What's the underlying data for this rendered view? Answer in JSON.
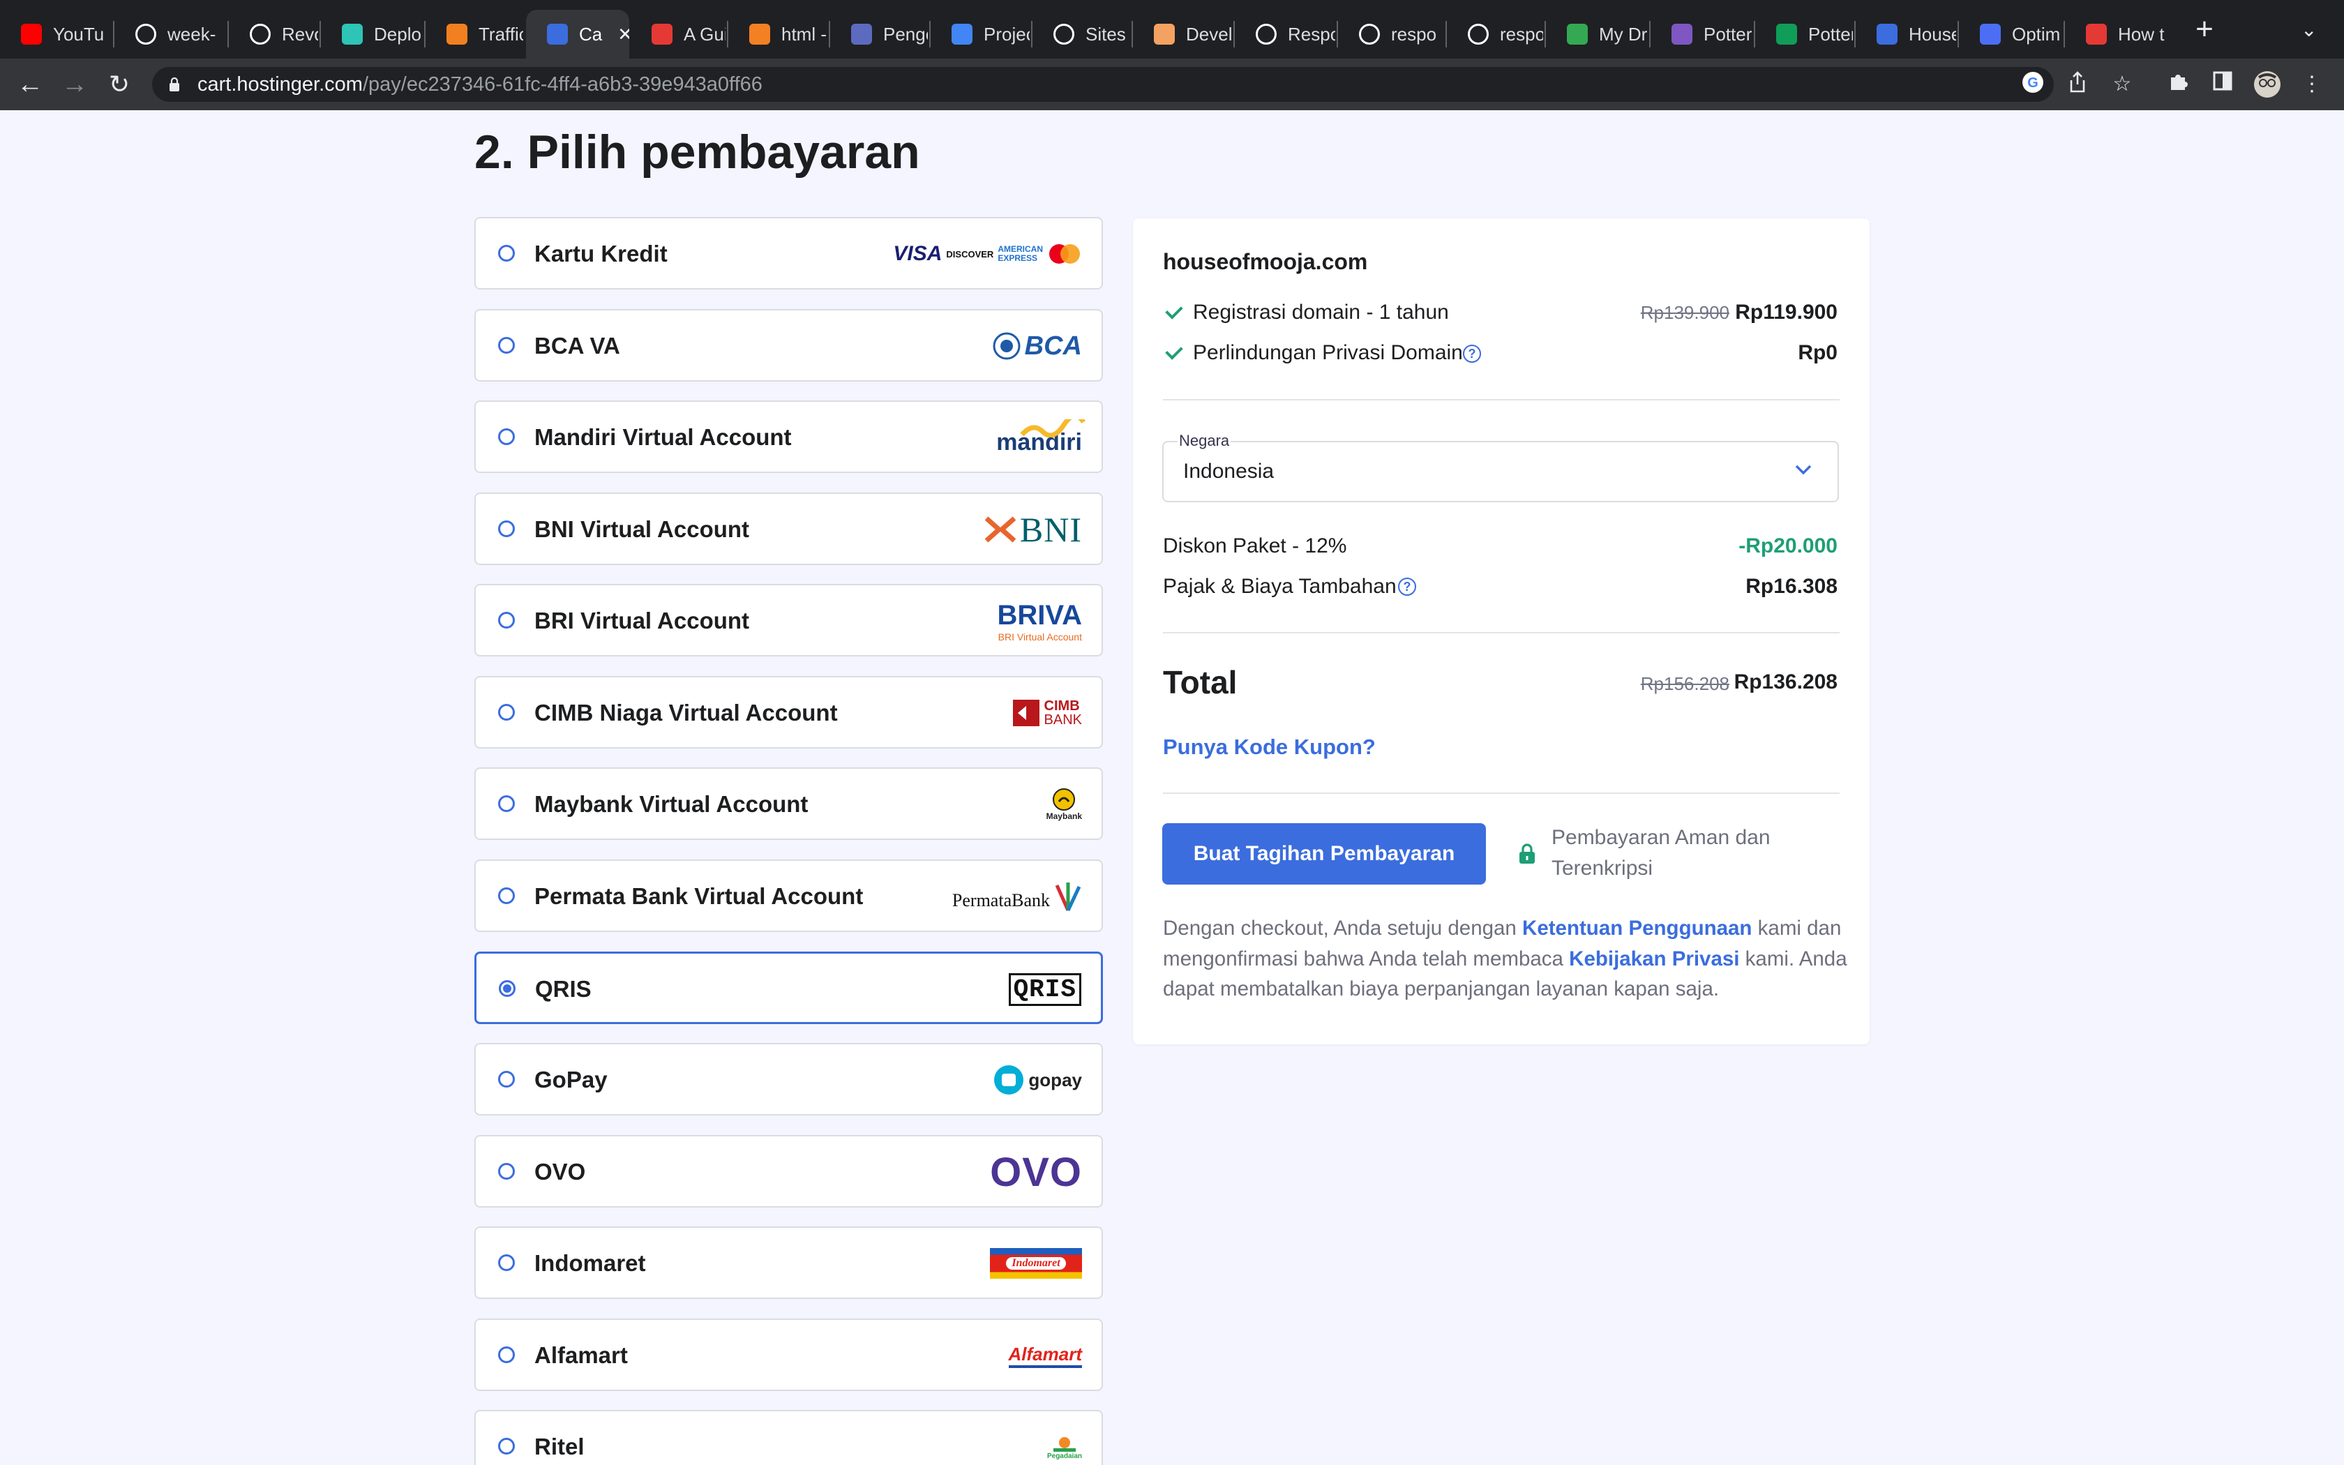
{
  "browser": {
    "tabs": [
      {
        "title": "YouTu",
        "icon": "youtube-icon",
        "color": "#ff0000"
      },
      {
        "title": "week-",
        "icon": "github-icon",
        "color": "#ffffff"
      },
      {
        "title": "Revol",
        "icon": "github-icon",
        "color": "#ffffff"
      },
      {
        "title": "Deplo",
        "icon": "diamond-icon",
        "color": "#2ec4b6"
      },
      {
        "title": "Traffic",
        "icon": "cloudflare-icon",
        "color": "#f38020"
      },
      {
        "title": "Ca",
        "icon": "hostinger-icon",
        "color": "#3b6dde"
      },
      {
        "title": "A Gui",
        "icon": "stop-icon",
        "color": "#e53935"
      },
      {
        "title": "html -",
        "icon": "stackoverflow-icon",
        "color": "#f48024"
      },
      {
        "title": "Penge",
        "icon": "badge-icon",
        "color": "#5c6bc0"
      },
      {
        "title": "Projec",
        "icon": "docs-icon",
        "color": "#4285f4"
      },
      {
        "title": "Sites",
        "icon": "webflow-icon",
        "color": "#ffffff"
      },
      {
        "title": "Develo",
        "icon": "cube-icon",
        "color": "#f4a261"
      },
      {
        "title": "Respo",
        "icon": "compass-icon",
        "color": "#ffffff"
      },
      {
        "title": "respo",
        "icon": "google-icon",
        "color": "#ffffff"
      },
      {
        "title": "respo",
        "icon": "github-icon",
        "color": "#ffffff"
      },
      {
        "title": "My Dr",
        "icon": "drive-icon",
        "color": "#34a853"
      },
      {
        "title": "Potter",
        "icon": "forms-icon",
        "color": "#7e57c2"
      },
      {
        "title": "Potter",
        "icon": "sheets-icon",
        "color": "#0f9d58"
      },
      {
        "title": "House",
        "icon": "hostinger-icon",
        "color": "#3b6dde"
      },
      {
        "title": "Optim",
        "icon": "person-icon",
        "color": "#4c6ef5"
      },
      {
        "title": "How t",
        "icon": "dot-icon",
        "color": "#e53935"
      }
    ],
    "active_tab_close": "✕",
    "url_host": "cart.hostinger.com",
    "url_path": "/pay/ec237346-61fc-4ff4-a6b3-39e943a0ff66"
  },
  "page": {
    "heading": "2. Pilih pembayaran",
    "methods": [
      {
        "label": "Kartu Kredit",
        "selected": false
      },
      {
        "label": "BCA VA",
        "selected": false
      },
      {
        "label": "Mandiri Virtual Account",
        "selected": false
      },
      {
        "label": "BNI Virtual Account",
        "selected": false
      },
      {
        "label": "BRI Virtual Account",
        "selected": false
      },
      {
        "label": "CIMB Niaga Virtual Account",
        "selected": false
      },
      {
        "label": "Maybank Virtual Account",
        "selected": false
      },
      {
        "label": "Permata Bank Virtual Account",
        "selected": false
      },
      {
        "label": "QRIS",
        "selected": true
      },
      {
        "label": "GoPay",
        "selected": false
      },
      {
        "label": "OVO",
        "selected": false
      },
      {
        "label": "Indomaret",
        "selected": false
      },
      {
        "label": "Alfamart",
        "selected": false
      },
      {
        "label": "Ritel",
        "selected": false
      }
    ],
    "logos": {
      "visa": "VISA",
      "discover": "DISCOVER",
      "amex1": "AMERICAN",
      "amex2": "EXPRESS",
      "bca": "BCA",
      "mandiri": "mandiri",
      "bni": "BNI",
      "briva": "BRIVA",
      "briva_sub": "BRI Virtual Account",
      "cimb1": "CIMB",
      "cimb2": "BANK",
      "maybank": "Maybank",
      "permata": "PermataBank",
      "qris": "QRIS",
      "gopay": "gopay",
      "ovo": "OVO",
      "indomaret": "Indomaret",
      "alfamart": "Alfamart",
      "pegadaian": "Pegadaian"
    }
  },
  "summary": {
    "domain": "houseofmooja.com",
    "items": [
      {
        "label": "Registrasi domain - 1 tahun",
        "old_price": "Rp139.900",
        "price": "Rp119.900"
      },
      {
        "label": "Perlindungan Privasi Domain",
        "price": "Rp0"
      }
    ],
    "country_label": "Negara",
    "country_value": "Indonesia",
    "discount_label": "Diskon Paket - 12%",
    "discount_value": "-Rp20.000",
    "tax_label": "Pajak & Biaya Tambahan",
    "tax_value": "Rp16.308",
    "total_label": "Total",
    "total_old": "Rp156.208",
    "total_value": "Rp136.208",
    "coupon_link": "Punya Kode Kupon?",
    "cta": "Buat Tagihan Pembayaran",
    "secure_line1": "Pembayaran Aman dan",
    "secure_line2": "Terenkripsi",
    "terms_part1": "Dengan checkout, Anda setuju dengan ",
    "terms_link1": "Ketentuan Penggunaan",
    "terms_part2": " kami dan",
    "terms_part3": "mengonfirmasi bahwa Anda telah membaca ",
    "terms_link2": "Kebijakan Privasi",
    "terms_part4": " kami. Anda",
    "terms_part5": "dapat membatalkan biaya perpanjangan layanan kapan saja."
  }
}
